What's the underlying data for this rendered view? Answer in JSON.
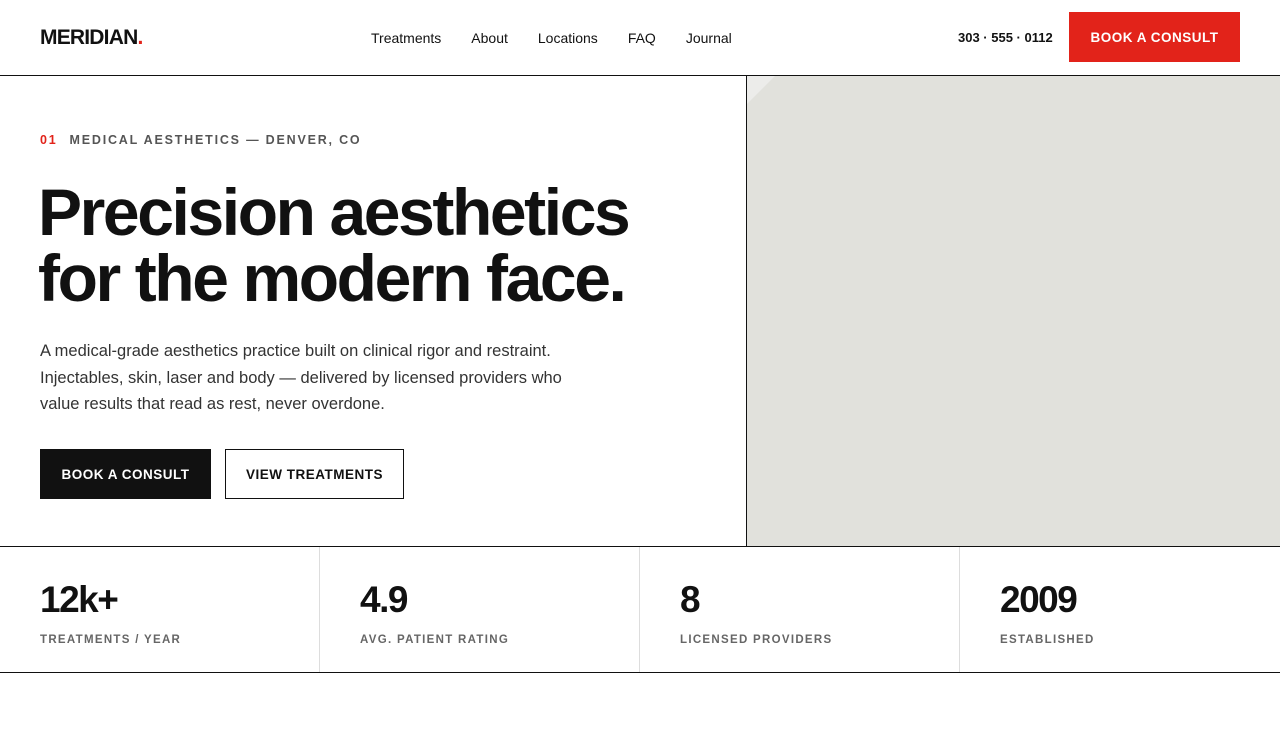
{
  "header": {
    "logo_text": "MERIDIAN",
    "logo_dot": ".",
    "nav": [
      "Treatments",
      "About",
      "Locations",
      "FAQ",
      "Journal"
    ],
    "phone": "303 · 555 · 0112",
    "cta_label": "BOOK A CONSULT"
  },
  "hero": {
    "eyebrow_number": "01",
    "eyebrow_text": "MEDICAL AESTHETICS — DENVER, CO",
    "headline_line1": "Precision aesthetics",
    "headline_line2": "for the modern face.",
    "lede": "A medical-grade aesthetics practice built on clinical rigor and restraint. Injectables, skin, laser and body — delivered by licensed providers who value results that read as rest, never overdone.",
    "primary_cta": "BOOK A CONSULT",
    "secondary_cta": "VIEW TREATMENTS"
  },
  "stats": [
    {
      "value": "12k+",
      "label": "TREATMENTS / YEAR"
    },
    {
      "value": "4.9",
      "label": "AVG. PATIENT RATING"
    },
    {
      "value": "8",
      "label": "LICENSED PROVIDERS"
    },
    {
      "value": "2009",
      "label": "ESTABLISHED"
    }
  ],
  "colors": {
    "accent": "#e2231a",
    "ink": "#111111",
    "image_placeholder": "#e1e1dc"
  }
}
